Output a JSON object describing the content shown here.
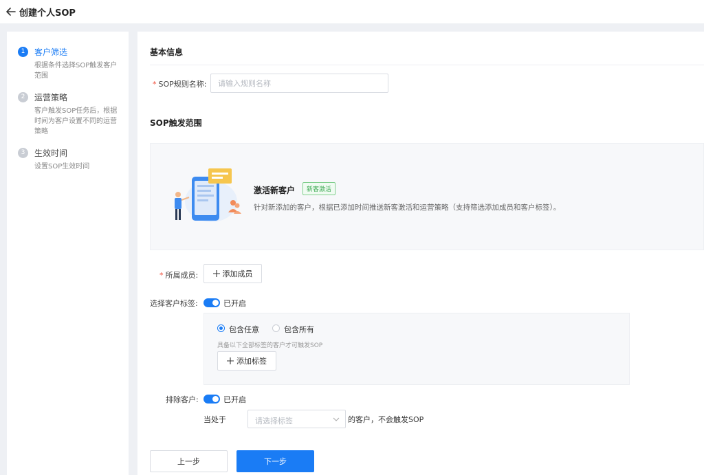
{
  "header": {
    "title": "创建个人SOP"
  },
  "steps": [
    {
      "num": "1",
      "title": "客户筛选",
      "desc": "根据条件选择SOP触发客户范围"
    },
    {
      "num": "2",
      "title": "运营策略",
      "desc": "客户触发SOP任务后，根据时间为客户设置不同的运营策略"
    },
    {
      "num": "3",
      "title": "生效时间",
      "desc": "设置SOP生效时间"
    }
  ],
  "basic": {
    "title": "基本信息",
    "required_mark": "*",
    "name_label": "SOP规则名称:",
    "name_value": "",
    "name_placeholder": "请输入规则名称"
  },
  "scope": {
    "title": "SOP触发范围",
    "card_name": "激活新客户",
    "card_tag": "新客激活",
    "card_desc": "针对新添加的客户，根据已添加时间推送新客激活和运营策略（支持筛选添加成员和客户标签）。"
  },
  "members": {
    "label": "所属成员:",
    "button": "添加成员"
  },
  "tags": {
    "label": "选择客户标签:",
    "switch_text": "已开启",
    "option_any": "包含任意",
    "option_all": "包含所有",
    "hint": "具备以下全部标签的客户才可触发SOP",
    "add_button": "添加标签"
  },
  "exclude": {
    "label": "排除客户:",
    "switch_text": "已开启",
    "prefix": "当处于",
    "select_placeholder": "请选择标签",
    "suffix": "的客户，不会触发SOP"
  },
  "actions": {
    "prev": "上一步",
    "next": "下一步"
  },
  "colors": {
    "primary": "#1a7cf5",
    "required": "#f0503c",
    "tag_green": "#3aa850"
  }
}
